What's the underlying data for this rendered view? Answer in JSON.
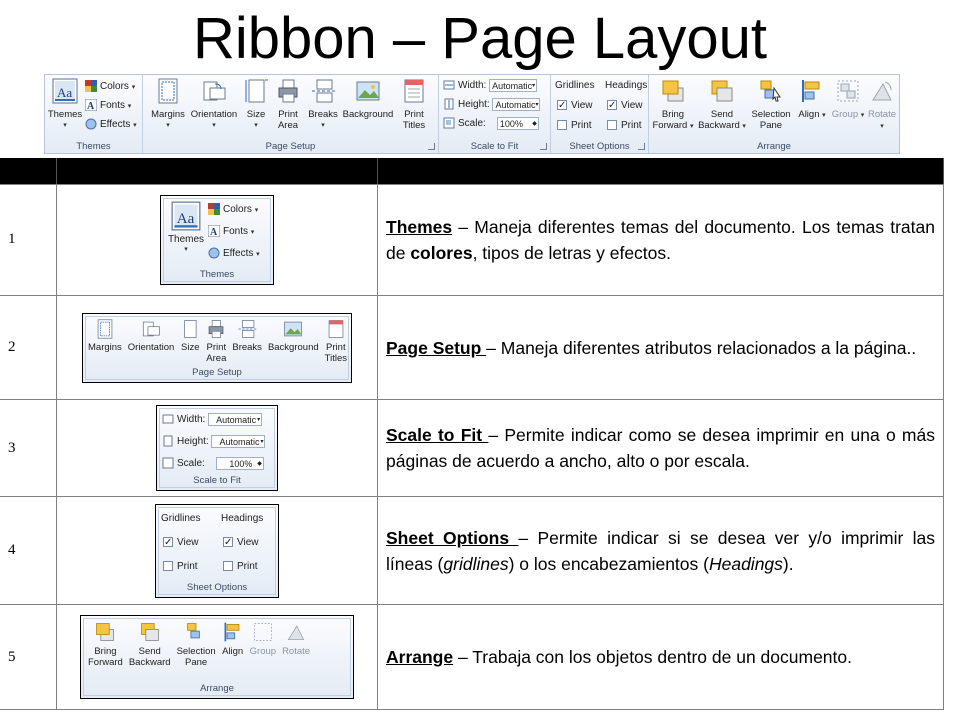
{
  "title": "Ribbon – Page Layout",
  "ribbon": {
    "themes": {
      "button": "Themes",
      "colors": "Colors",
      "fonts": "Fonts",
      "effects": "Effects",
      "label": "Themes"
    },
    "page_setup": {
      "buttons": [
        {
          "label1": "Margins",
          "label2": ""
        },
        {
          "label1": "Orientation",
          "label2": ""
        },
        {
          "label1": "Size",
          "label2": ""
        },
        {
          "label1": "Print",
          "label2": "Area"
        },
        {
          "label1": "Breaks",
          "label2": ""
        },
        {
          "label1": "Background",
          "label2": ""
        },
        {
          "label1": "Print",
          "label2": "Titles"
        }
      ],
      "label": "Page Setup"
    },
    "scale_to_fit": {
      "width_label": "Width:",
      "width_value": "Automatic",
      "height_label": "Height:",
      "height_value": "Automatic",
      "scale_label": "Scale:",
      "scale_value": "100%",
      "label": "Scale to Fit"
    },
    "sheet_options": {
      "gridlines": "Gridlines",
      "headings": "Headings",
      "view": "View",
      "print": "Print",
      "gridlines_view": true,
      "gridlines_print": false,
      "headings_view": true,
      "headings_print": false,
      "label": "Sheet Options"
    },
    "arrange": {
      "buttons": [
        {
          "label1": "Bring",
          "label2": "Forward"
        },
        {
          "label1": "Send",
          "label2": "Backward"
        },
        {
          "label1": "Selection",
          "label2": "Pane"
        },
        {
          "label1": "Align",
          "label2": ""
        },
        {
          "label1": "Group",
          "label2": ""
        },
        {
          "label1": "Rotate",
          "label2": ""
        }
      ],
      "label": "Arrange"
    }
  },
  "rows": [
    {
      "num": "1",
      "keyword": "Themes",
      "text_before": " – Maneja diferentes temas del documento. Los temas tratan de ",
      "bold": "colores",
      "text_after": ", tipos de letras y efectos."
    },
    {
      "num": "2",
      "keyword": "Page Setup ",
      "text": " – Maneja diferentes atributos relacionados a la página.."
    },
    {
      "num": "3",
      "keyword": "Scale to Fit ",
      "text": " – Permite indicar como se desea imprimir en una o más páginas de acuerdo a ancho, alto o por escala."
    },
    {
      "num": "4",
      "keyword": "Sheet Options ",
      "text_before": " – Permite indicar si se desea ver y/o imprimir las líneas (",
      "italic1": "gridlines",
      "text_mid": ") o los encabezamientos (",
      "italic2": "Headings",
      "text_after": ")."
    },
    {
      "num": "5",
      "keyword": "Arrange",
      "text": " – Trabaja con los objetos dentro de un documento."
    }
  ],
  "colors": {
    "header_bar": "#000000",
    "ribbon_bg": "#e4ebf5",
    "ribbon_border": "#b6c5d9"
  }
}
